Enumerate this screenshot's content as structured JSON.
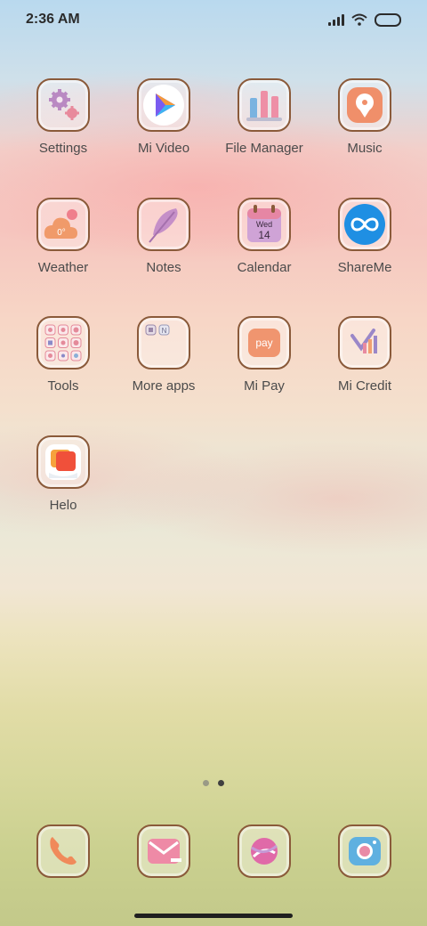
{
  "status_bar": {
    "time": "2:36 AM"
  },
  "apps": [
    {
      "label": "Settings",
      "icon": "gear-icon"
    },
    {
      "label": "Mi Video",
      "icon": "play-icon"
    },
    {
      "label": "File Manager",
      "icon": "file-bars-icon"
    },
    {
      "label": "Music",
      "icon": "music-pin-icon"
    },
    {
      "label": "Weather",
      "icon": "weather-cloud-icon",
      "badge": "0°"
    },
    {
      "label": "Notes",
      "icon": "feather-icon"
    },
    {
      "label": "Calendar",
      "icon": "calendar-icon",
      "day": "Wed",
      "date": "14"
    },
    {
      "label": "ShareMe",
      "icon": "infinity-icon"
    },
    {
      "label": "Tools",
      "icon": "tools-grid-icon"
    },
    {
      "label": "More apps",
      "icon": "folder-icon"
    },
    {
      "label": "Mi Pay",
      "icon": "pay-icon",
      "text": "pay"
    },
    {
      "label": "Mi Credit",
      "icon": "credit-chart-icon"
    },
    {
      "label": "Helo",
      "icon": "chat-bubbles-icon"
    }
  ],
  "page_indicator": {
    "count": 2,
    "active": 2
  },
  "dock": [
    {
      "icon": "phone-icon"
    },
    {
      "icon": "message-icon"
    },
    {
      "icon": "browser-icon"
    },
    {
      "icon": "camera-icon"
    }
  ],
  "colors": {
    "icon_border": "#8a5a3a",
    "label": "#4b4b4b"
  }
}
